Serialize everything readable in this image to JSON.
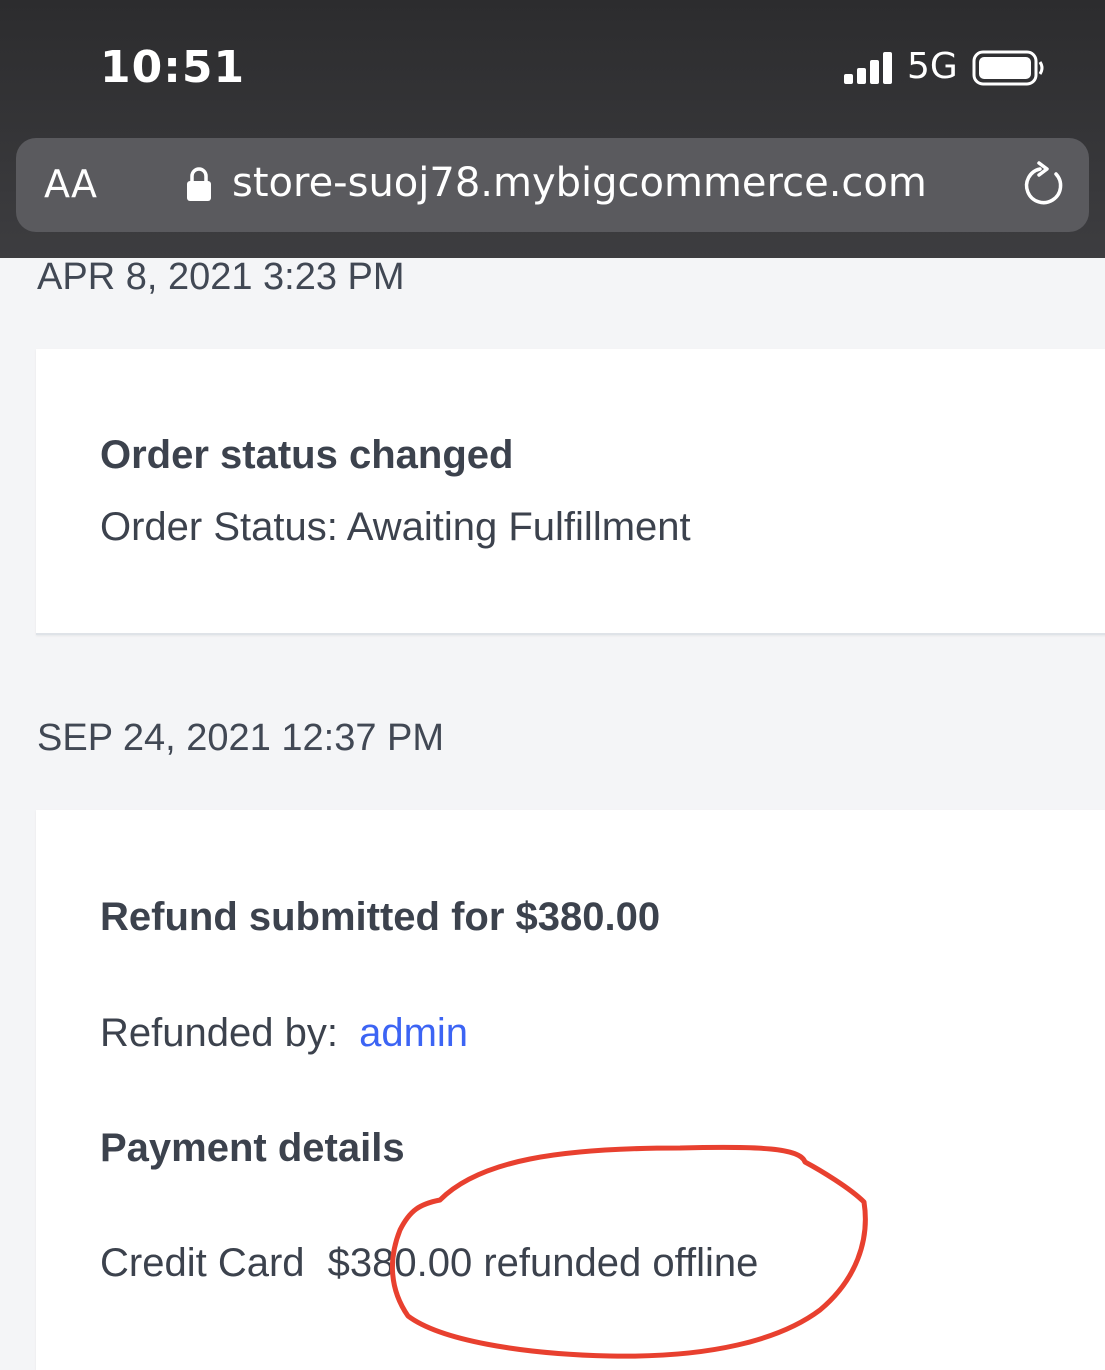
{
  "status_bar": {
    "time": "10:51",
    "network": "5G",
    "signal_icon": "cellular-signal-icon",
    "battery_icon": "battery-icon"
  },
  "address_bar": {
    "text_size_label": "AA",
    "url": "store-suoj78.mybigcommerce.com",
    "lock_icon": "lock-icon",
    "reload_icon": "reload-icon"
  },
  "timeline": [
    {
      "date": "APR 8, 2021 3:23 PM",
      "title": "Order status changed",
      "detail": "Order Status: Awaiting Fulfillment"
    },
    {
      "date": "SEP 24, 2021 12:37 PM",
      "title": "Refund submitted for $380.00",
      "refunded_by_label": "Refunded by:",
      "refunded_by_user": "admin",
      "payment_heading": "Payment details",
      "payment_method": "Credit Card",
      "payment_summary": "$380.00 refunded offline"
    }
  ],
  "colors": {
    "link": "#3c64f4",
    "annotation": "#e8402f",
    "background": "#f4f5f7"
  }
}
